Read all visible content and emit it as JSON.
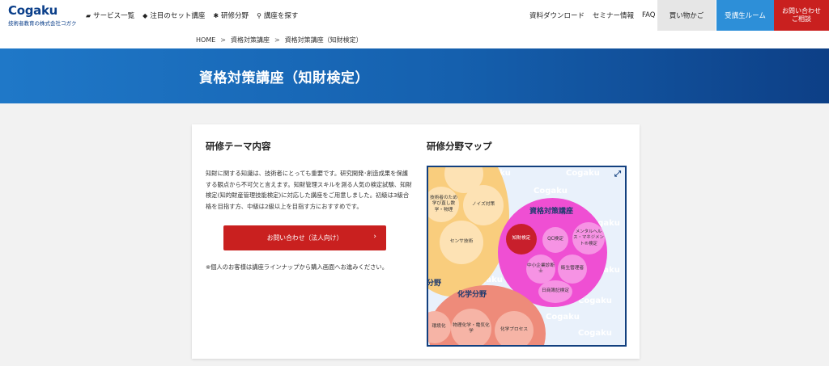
{
  "header": {
    "logo": {
      "name": "Cogaku",
      "tagline": "技術者教育の株式会社コガク"
    },
    "nav": [
      {
        "icon": "folder-icon",
        "glyph": "▰",
        "label": "サービス一覧"
      },
      {
        "icon": "cube-icon",
        "glyph": "◆",
        "label": "注目のセット講座"
      },
      {
        "icon": "gears-icon",
        "glyph": "✱",
        "label": "研修分野"
      },
      {
        "icon": "search-icon",
        "glyph": "⚲",
        "label": "講座を探す"
      }
    ],
    "links": [
      "資料ダウンロード",
      "セミナー情報",
      "FAQ"
    ],
    "cart": "買い物かご",
    "room": "受講生ルーム",
    "contact_line1": "お問い合わせ",
    "contact_line2": "ご相談"
  },
  "breadcrumb": [
    "HOME",
    "資格対策講座",
    "資格対策講座（知財検定）"
  ],
  "banner": {
    "title": "資格対策講座（知財検定）"
  },
  "theme": {
    "title": "研修テーマ内容",
    "description": "知財に関する知識は、技術者にとっても重要です。研究開発･創造成果を保護する観点から不可欠と言えます。知財管理スキルを測る人気の検定試験、知財検定(知的財産管理技能検定)に対応した講座をご用意しました。初級は3級合格を目指す方、中級は2級以上を目指す方におすすめです。",
    "cta": "お問い合わせ（法人向け）",
    "note": "※個人のお客様は講座ラインナップから購入画面へお進みください。"
  },
  "map": {
    "title": "研修分野マップ",
    "watermark": "Cogaku",
    "yellow_items": [
      "技術者のため学び直し数学・物理",
      "ノイズ対策",
      "センサ技術"
    ],
    "yellow_partial_title": "分野",
    "pink_title": "資格対策講座",
    "pink_items": [
      "知財検定",
      "QC検定",
      "メンタルヘルス・マネジメント®検定",
      "中小企業診断士",
      "衛生管理者",
      "日商簿記検定"
    ],
    "red_title": "化学分野",
    "red_items": [
      "環境化",
      "物理化学・電気化学",
      "化学プロセス"
    ]
  },
  "colors": {
    "brand": "#0b3f8a",
    "accent_red": "#c9201f",
    "accent_blue": "#2d8fd8",
    "map_yellow": "#f9cd7d",
    "map_pink": "#ef4fd3",
    "map_red": "#ee8b7a"
  }
}
